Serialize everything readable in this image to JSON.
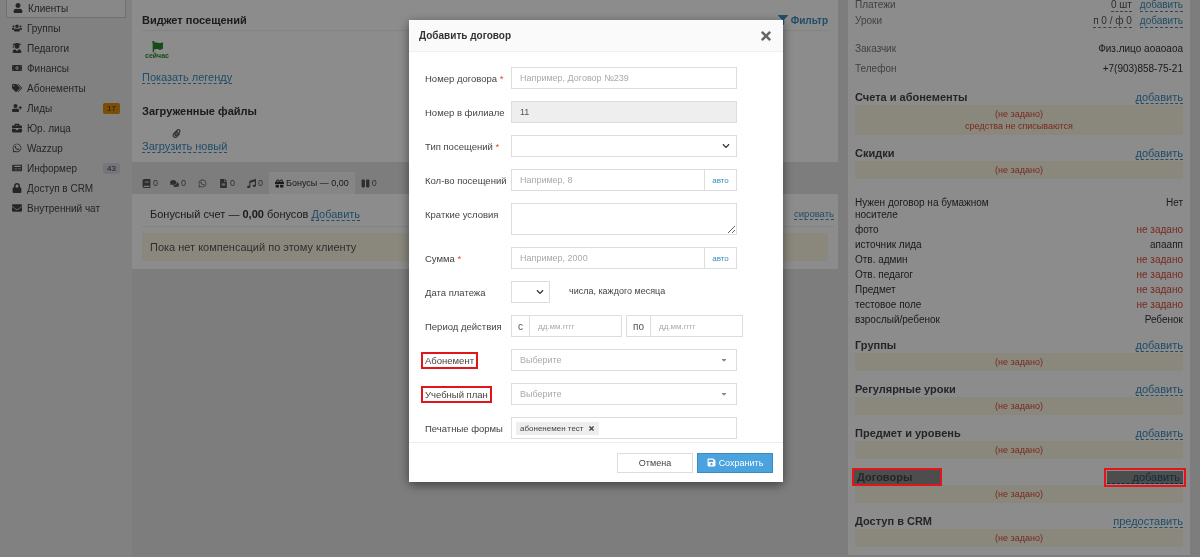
{
  "sidebar": {
    "items": [
      {
        "label": "Клиенты",
        "selected": true
      },
      {
        "label": "Группы",
        "selected": false
      },
      {
        "label": "Педагоги",
        "selected": false
      },
      {
        "label": "Финансы",
        "selected": false
      },
      {
        "label": "Абонементы",
        "selected": false
      },
      {
        "label": "Лиды",
        "selected": false,
        "badge": "17",
        "color": "#7b4e06"
      },
      {
        "label": "Юр. лица",
        "selected": false
      },
      {
        "label": "Wazzup",
        "selected": false
      },
      {
        "label": "Информер",
        "selected": false,
        "badge": "43",
        "color": "#74767a"
      },
      {
        "label": "Доступ в CRM",
        "selected": false
      },
      {
        "label": "Внутренний чат",
        "selected": false
      }
    ]
  },
  "widget": {
    "title": "Виджет посещений",
    "filter": "Фильтр",
    "flag_label": "сейчас",
    "legend_link": "Показать легенду"
  },
  "files": {
    "title": "Загруженные файлы",
    "upload_link": "Загрузить новый"
  },
  "tabs": [
    {
      "label": "0",
      "selected": false
    },
    {
      "label": "0",
      "selected": false
    },
    {
      "selected": false
    },
    {
      "label": "0",
      "selected": false
    },
    {
      "label": "0",
      "selected": false
    },
    {
      "label": "Бонусы — 0,00",
      "selected": true
    },
    {
      "label": "0",
      "selected": false
    }
  ],
  "bonus": {
    "text": "Бонусный счет — **0,00** бонусов",
    "link": "Добавить",
    "right_link": "сировать",
    "notice": "Пока нет компенсаций по этому клиенту"
  },
  "modal": {
    "title": "Добавить договор",
    "required_mark": "*",
    "fields": [
      {
        "kind": "text",
        "label": "Номер договора",
        "required": true,
        "highlighted": false,
        "placeholder": "Например, Договор №239"
      },
      {
        "kind": "readonly",
        "label": "Номер в филиале",
        "required": false,
        "highlighted": false,
        "value": "11"
      },
      {
        "kind": "select",
        "label": "Тип посещений",
        "required": true,
        "highlighted": false
      },
      {
        "kind": "addon",
        "label": "Кол-во посещений",
        "required": false,
        "highlighted": false,
        "placeholder": "Например, 8",
        "addon": "авто"
      },
      {
        "kind": "textarea",
        "label": "Краткие условия",
        "required": false,
        "highlighted": false
      },
      {
        "kind": "addon",
        "label": "Сумма",
        "required": true,
        "highlighted": false,
        "placeholder": "Например, 2000",
        "addon": "авто"
      },
      {
        "kind": "day",
        "label": "Дата платежа",
        "required": false,
        "highlighted": false,
        "suffix": "числа, каждого месяца"
      },
      {
        "kind": "period",
        "label": "Период действия",
        "required": false,
        "highlighted": false,
        "from": "с",
        "from_placeholder": "дд.мм.гггг",
        "to": "по",
        "to_placeholder": "дд.мм.гггг"
      },
      {
        "kind": "choice",
        "label": "Абонемент",
        "required": false,
        "highlighted": true,
        "placeholder": "Выберите"
      },
      {
        "kind": "choice",
        "label": "Учебный план",
        "required": false,
        "highlighted": true,
        "placeholder": "Выберите"
      },
      {
        "kind": "tags",
        "label": "Печатные формы",
        "required": false,
        "highlighted": false,
        "tags": [
          "абоненемен тест"
        ]
      }
    ],
    "buttons": [
      {
        "label": "Отмена",
        "primary": false
      },
      {
        "label": "Сохранить",
        "primary": true
      }
    ]
  },
  "client": {
    "stats": [
      {
        "label": "Платежи",
        "value": "0 шт",
        "action": "добавить"
      },
      {
        "label": "Уроки",
        "value": "п 0 / ф 0",
        "action": "добавить"
      }
    ],
    "contacts": [
      {
        "label": "Заказчик",
        "value": "Физ.лицо аоаоаоа"
      },
      {
        "label": "Телефон",
        "value": "+7(903)858-75-21"
      }
    ],
    "blocks": [
      {
        "kind": "section",
        "title": "Счета и абонементы",
        "action": "добавить",
        "highlighted": false,
        "notes": [
          "(не задано)",
          "средства не списываются"
        ]
      },
      {
        "kind": "section",
        "title": "Скидки",
        "action": "добавить",
        "highlighted": false,
        "notes": [
          "(не задано)"
        ]
      },
      {
        "kind": "fields",
        "rows": [
          {
            "label": "Нужен договор на бумажном носителе",
            "value": "Нет",
            "missing": false
          },
          {
            "label": "фото",
            "value": "не задано",
            "missing": true
          },
          {
            "label": "источник лида",
            "value": "апаапп",
            "missing": false
          },
          {
            "label": "Отв. админ",
            "value": "не задано",
            "missing": true
          },
          {
            "label": "Отв. педагог",
            "value": "не задано",
            "missing": true
          },
          {
            "label": "Предмет",
            "value": "не задано",
            "missing": true
          },
          {
            "label": "тестовое поле",
            "value": "не задано",
            "missing": true
          },
          {
            "label": "взрослый/ребенок",
            "value": "Ребенок",
            "missing": false
          }
        ]
      },
      {
        "kind": "section",
        "title": "Группы",
        "action": "добавить",
        "highlighted": false,
        "notes": [
          "(не задано)"
        ]
      },
      {
        "kind": "section",
        "title": "Регулярные уроки",
        "action": "добавить",
        "highlighted": false,
        "notes": [
          "(не задано)"
        ]
      },
      {
        "kind": "section",
        "title": "Предмет и уровень",
        "action": "добавить",
        "highlighted": false,
        "notes": [
          "(не задано)"
        ]
      },
      {
        "kind": "section",
        "title": "Договоры",
        "action": "добавить",
        "highlighted": true,
        "notes": [
          "(не задано)"
        ]
      },
      {
        "kind": "section",
        "title": "Доступ в CRM",
        "action": "предоставить",
        "highlighted": false,
        "notes": [
          "(не задано)"
        ]
      }
    ]
  }
}
